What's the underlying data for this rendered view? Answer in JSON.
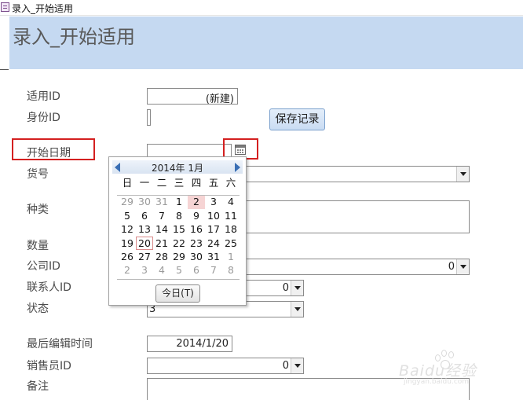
{
  "window": {
    "title": "录入_开始适用"
  },
  "form": {
    "title": "录入_开始适用",
    "labels": {
      "syid": "适用ID",
      "sfid": "身份ID",
      "start_date": "开始日期",
      "product_no": "货号",
      "category": "种类",
      "quantity": "数量",
      "company_id": "公司ID",
      "contact_id": "联系人ID",
      "status": "状态",
      "last_edit": "最后编辑时间",
      "sales_id": "销售员ID",
      "notes": "备注"
    },
    "values": {
      "syid": "(新建)",
      "company_id": "0",
      "contact_id": "0",
      "status": "3",
      "last_edit": "2014/1/20",
      "sales_id": "0"
    },
    "save_button": "保存记录"
  },
  "calendar": {
    "month_label": "2014年 1月",
    "weekdays": [
      "日",
      "一",
      "二",
      "三",
      "四",
      "五",
      "六"
    ],
    "weeks": [
      [
        "29",
        "30",
        "31",
        "1",
        "2",
        "3",
        "4"
      ],
      [
        "5",
        "6",
        "7",
        "8",
        "9",
        "10",
        "11"
      ],
      [
        "12",
        "13",
        "14",
        "15",
        "16",
        "17",
        "18"
      ],
      [
        "19",
        "20",
        "21",
        "22",
        "23",
        "24",
        "25"
      ],
      [
        "26",
        "27",
        "28",
        "29",
        "30",
        "31",
        "1"
      ],
      [
        "2",
        "3",
        "4",
        "5",
        "6",
        "7",
        "8"
      ]
    ],
    "selected_day": "2",
    "today_day": "20",
    "today_button": "今日(T)"
  },
  "watermark": {
    "text": "Baidu经验",
    "url": "jingyan.baidu.com"
  },
  "colors": {
    "header_band": "#c5d9f1",
    "highlight_box": "#d42020",
    "selected_day": "#f6d4d4"
  },
  "icons": [
    "form-icon",
    "calendar-icon",
    "prev-month-icon",
    "next-month-icon",
    "dropdown-arrow-icon"
  ]
}
